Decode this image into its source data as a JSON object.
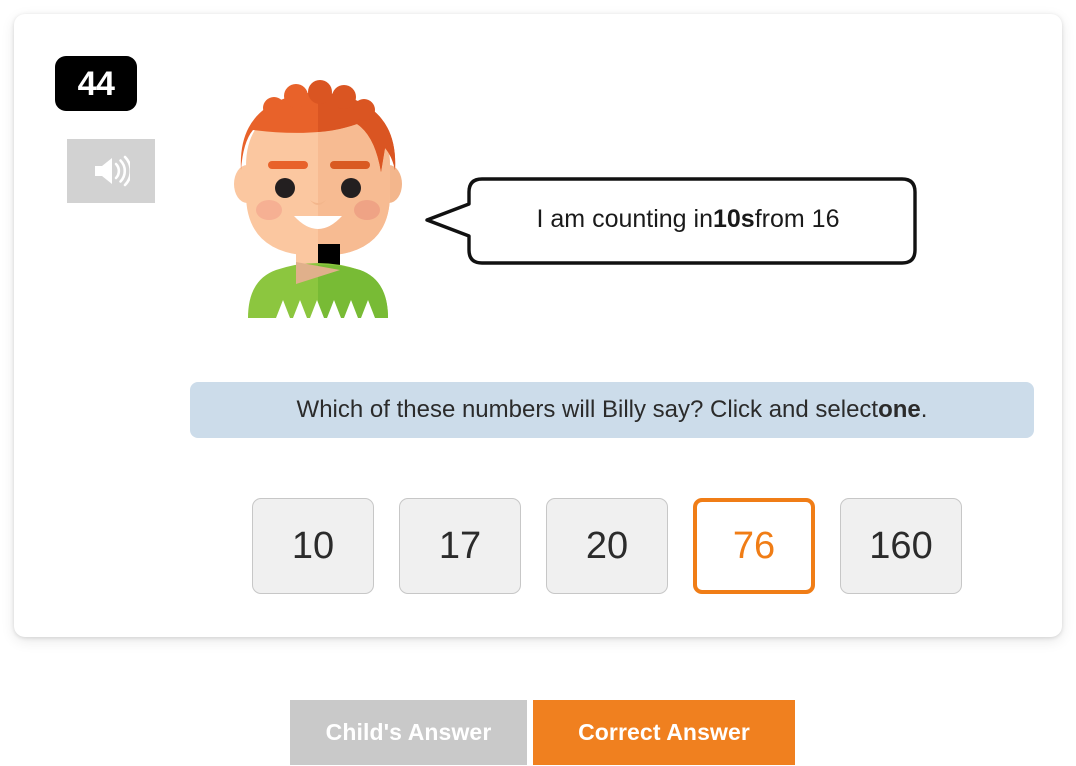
{
  "question_card": {
    "question_number": "44",
    "audio_icon": "speaker-icon",
    "avatar": {
      "icon": "boy-avatar",
      "hair_color": "#e8622a",
      "skin_color": "#fbc7a0",
      "shirt_color": "#8cc63f"
    },
    "speech_bubble": {
      "text_before": "I am counting in ",
      "text_bold": "10s",
      "text_after": " from 16",
      "full_text": "I am counting in 10s from 16"
    },
    "prompt": {
      "text_before": "Which of these numbers will Billy say? Click and select ",
      "text_bold": "one",
      "text_after": ".",
      "full_text": "Which of these numbers will Billy say? Click and select one.",
      "background_color": "#ccdcea"
    },
    "answer_options": [
      {
        "label": "10",
        "selected": false
      },
      {
        "label": "17",
        "selected": false
      },
      {
        "label": "20",
        "selected": false
      },
      {
        "label": "76",
        "selected": true
      },
      {
        "label": "160",
        "selected": false
      }
    ]
  },
  "footer": {
    "childs_answer_label": "Child's Answer",
    "correct_answer_label": "Correct Answer",
    "childs_answer_color": "#c9c9c9",
    "correct_answer_color": "#f0801f"
  },
  "colors": {
    "accent_orange": "#f0801f",
    "selected_border": "#f07d16",
    "prompt_blue": "#ccdcea",
    "badge_black": "#000000"
  }
}
